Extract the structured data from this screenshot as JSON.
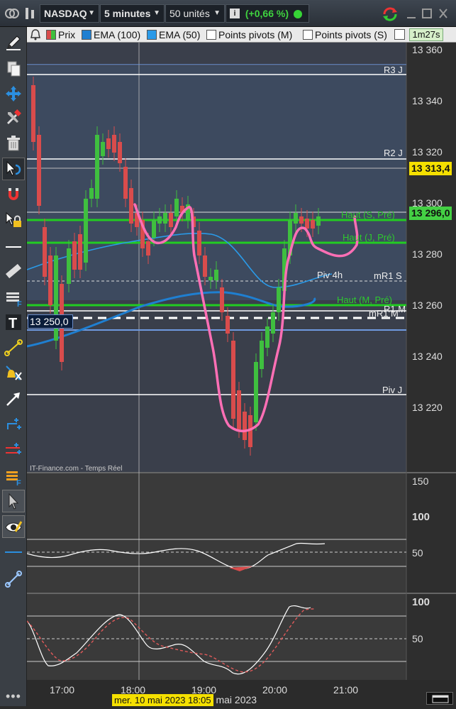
{
  "toolbar": {
    "symbol": "NASDAQ",
    "timeframe": "5 minutes",
    "units": "50 unités",
    "change": "(+0,66 %)",
    "countdown": "1m27s"
  },
  "legend": {
    "items": [
      {
        "label": "Prix",
        "color": "#d94c4c"
      },
      {
        "label": "EMA (100)",
        "color": "#1f7fd1"
      },
      {
        "label": "EMA (50)",
        "color": "#2a9ae8"
      },
      {
        "label": "Points pivots (M)",
        "color": "#ffffff"
      },
      {
        "label": "Points pivots (S)",
        "color": "#ffffff"
      }
    ]
  },
  "price_axis": {
    "ticks": [
      "13 360",
      "13 340",
      "13 320",
      "13 300",
      "13 280",
      "13 260",
      "13 240",
      "13 220"
    ],
    "badge_yellow": "13 313,4",
    "badge_green": "13 296,0",
    "cursor_value": "13 250,0"
  },
  "levels": {
    "r3j": "R3 J",
    "r2j": "R2 J",
    "haut_s": "Haut (S, Pré)",
    "haut_j": "Haut (J, Pré)",
    "piv4h": "Piv 4h",
    "mr1s": "mR1 S",
    "haut_m": "Haut (M, Pré)",
    "r1m": "R1 M",
    "mr1m": "mR1 M",
    "pivj": "Piv J"
  },
  "source": "IT-Finance.com - Temps Réel",
  "rsi_axis": {
    "ticks": [
      "150",
      "100",
      "50"
    ]
  },
  "stoch_axis": {
    "ticks": [
      "100",
      "50"
    ]
  },
  "time_axis": {
    "ticks": [
      "17:00",
      "18:00",
      "19:00",
      "20:00",
      "21:00"
    ],
    "cursor_date": "mer. 10 mai 2023 18:05",
    "date_label": "10 mai 2023"
  },
  "colors": {
    "up": "#3fbf3f",
    "down": "#d94c4c",
    "green_level": "#22cc22",
    "yellow_badge": "#f5e000",
    "green_badge": "#44d044",
    "annotation": "#ff6fb5"
  },
  "icons": [
    "pencil-icon",
    "copy-icon",
    "move-icon",
    "tools-icon",
    "trash-icon",
    "undo-cursor-icon",
    "magnet-icon",
    "lock-icon",
    "line-icon",
    "ruler-icon",
    "fibonacci-icon",
    "text-icon",
    "segment-icon",
    "alert-icon",
    "arrow-icon",
    "channel-icon",
    "parallel-icon",
    "indicator-icon",
    "pointer-icon",
    "eye-icon",
    "hline-icon",
    "link-icon"
  ]
}
